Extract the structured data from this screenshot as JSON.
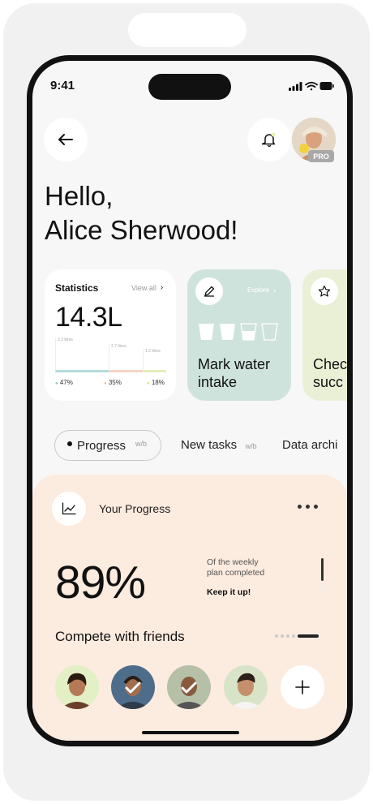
{
  "status_bar": {
    "time": "9:41"
  },
  "header": {
    "badge": "PRO"
  },
  "greeting": {
    "line1": "Hello,",
    "line2": "Alice Sherwood!"
  },
  "stats_card": {
    "title": "Statistics",
    "view_all": "View all",
    "value": "14.3L",
    "bars": [
      {
        "label": "3.3 litres",
        "percent": "47%",
        "dot_color": "#8fc3c6",
        "level": 0.47
      },
      {
        "label": "2.7 litres",
        "percent": "35%",
        "dot_color": "#f3b89a",
        "level": 0.35
      },
      {
        "label": "1.2 litres",
        "percent": "18%",
        "dot_color": "#cfe08a",
        "level": 0.18
      }
    ]
  },
  "water_card": {
    "explore": "Explore",
    "title_line1": "Mark water",
    "title_line2": "intake"
  },
  "check_card": {
    "title_line1": "Chec",
    "title_line2": "succ"
  },
  "tabs": [
    {
      "label": "Progress",
      "sub": "w/b",
      "active": true
    },
    {
      "label": "New tasks",
      "sub": "w/b",
      "active": false
    },
    {
      "label": "Data archi",
      "sub": "",
      "active": false
    }
  ],
  "progress": {
    "title": "Your Progress",
    "value": "89%",
    "description_line1": "Of the weekly",
    "description_line2": "plan completed",
    "encouragement": "Keep it up!",
    "compete": "Compete with friends"
  },
  "colors": {
    "screen_bg": "#f7f7f7",
    "water_card": "#cfe3dd",
    "check_card": "#eaf0d5",
    "progress_panel": "#fcebdf"
  }
}
